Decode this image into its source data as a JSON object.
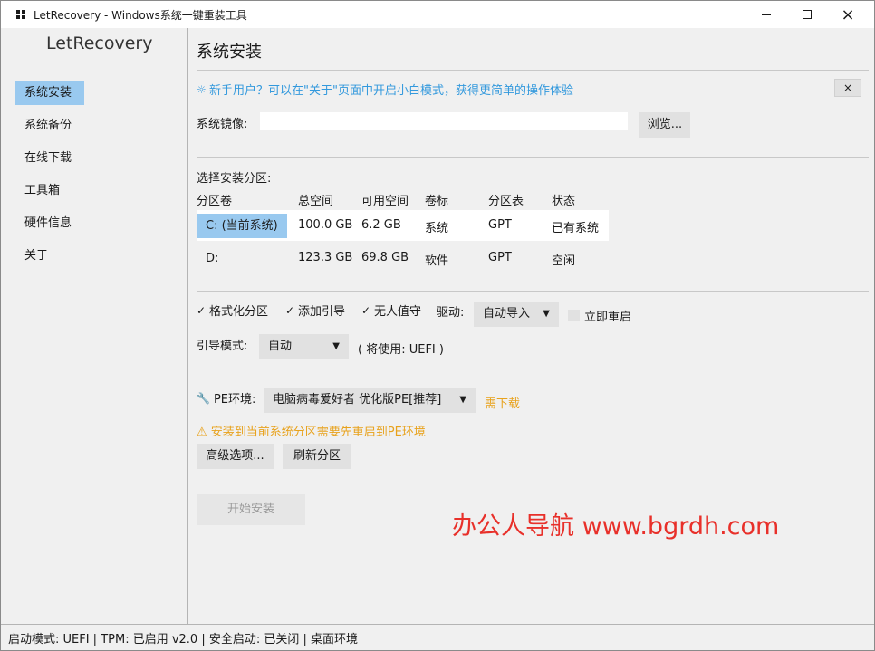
{
  "window": {
    "title": "LetRecovery - Windows系统一键重装工具",
    "controls": {
      "minimize": "minimize",
      "maximize": "maximize",
      "close": "×"
    }
  },
  "sidebar": {
    "logo": "LetRecovery",
    "items": [
      {
        "label": "系统安装",
        "active": true
      },
      {
        "label": "系统备份",
        "active": false
      },
      {
        "label": "在线下载",
        "active": false
      },
      {
        "label": "工具箱",
        "active": false
      },
      {
        "label": "硬件信息",
        "active": false
      },
      {
        "label": "关于",
        "active": false
      }
    ]
  },
  "main": {
    "title": "系统安装",
    "tip": {
      "text": "新手用户？可以在\"关于\"页面中开启小白模式，获得更简单的操作体验",
      "close": "×"
    },
    "image": {
      "label": "系统镜像:",
      "value": "",
      "browse": "浏览..."
    },
    "partition": {
      "section_label": "选择安装分区:",
      "headers": [
        "分区卷",
        "总空间",
        "可用空间",
        "卷标",
        "分区表",
        "状态"
      ],
      "rows": [
        {
          "vol": "C: (当前系统)",
          "total": "100.0 GB",
          "free": "6.2 GB",
          "label": "系统",
          "table": "GPT",
          "status": "已有系统",
          "selected": true
        },
        {
          "vol": "D:",
          "total": "123.3 GB",
          "free": "69.8 GB",
          "label": "软件",
          "table": "GPT",
          "status": "空闲",
          "selected": false
        }
      ]
    },
    "options": {
      "format": {
        "label": "格式化分区",
        "checked": true,
        "mark": "✓"
      },
      "add_boot": {
        "label": "添加引导",
        "checked": true,
        "mark": "✓"
      },
      "unattended": {
        "label": "无人值守",
        "checked": true,
        "mark": "✓"
      },
      "driver_label": "驱动:",
      "driver_value": "自动导入",
      "reboot": {
        "label": "立即重启",
        "checked": false
      }
    },
    "boot": {
      "label": "引导模式:",
      "value": "自动",
      "hint": "( 将使用: UEFI )"
    },
    "pe": {
      "label": "PE环境:",
      "icon": "wrench-icon",
      "value": "电脑病毒爱好者 优化版PE[推荐]",
      "download": "需下载",
      "warning": "⚠ 安装到当前系统分区需要先重启到PE环境"
    },
    "buttons": {
      "advanced": "高级选项...",
      "refresh": "刷新分区",
      "start": "开始安装"
    },
    "watermark": "办公人导航  www.bgrdh.com"
  },
  "status_bar": "启动模式: UEFI | TPM: 已启用 v2.0 | 安全启动: 已关闭 | 桌面环境",
  "colors": {
    "accent": "#99c9ef",
    "tip": "#3399dd",
    "warning": "#e8a21c",
    "watermark": "#e8302a"
  }
}
